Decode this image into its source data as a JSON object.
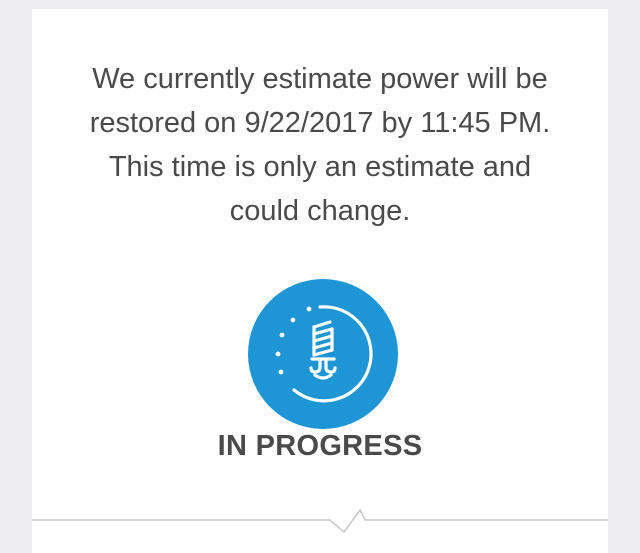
{
  "outage_card": {
    "estimate_lines": [
      "We currently estimate power will be",
      "restored on 9/22/2017 by 11:45 PM.",
      "This time is only an estimate and",
      "could change."
    ],
    "status_icon": "lightbulb-progress-icon",
    "status_label": "IN PROGRESS",
    "colors": {
      "accent": "#1e96d6",
      "text": "#4a4a4a",
      "background": "#eeeef0",
      "card": "#ffffff",
      "divider": "#c8c8c8"
    }
  }
}
